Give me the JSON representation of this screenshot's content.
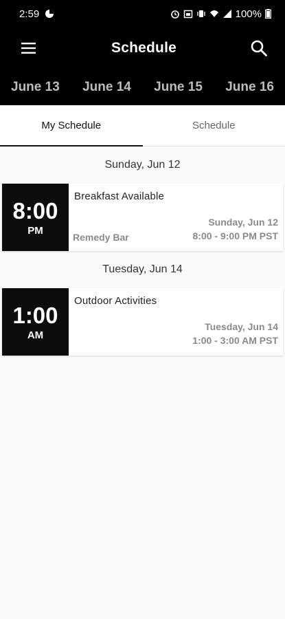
{
  "status_bar": {
    "time": "2:59",
    "battery": "100%",
    "icons": [
      "data-saver-icon",
      "alarm-icon",
      "calendar-icon",
      "vibrate-icon",
      "wifi-icon",
      "signal-icon",
      "battery-icon"
    ]
  },
  "app_bar": {
    "title": "Schedule",
    "menu_icon": "menu-icon",
    "search_icon": "search-icon"
  },
  "date_tabs": [
    {
      "label": "June 13"
    },
    {
      "label": "June 14"
    },
    {
      "label": "June 15"
    },
    {
      "label": "June 16"
    }
  ],
  "view_tabs": {
    "my_schedule": "My Schedule",
    "schedule": "Schedule",
    "active": "my_schedule"
  },
  "days": [
    {
      "header": "Sunday, Jun 12",
      "events": [
        {
          "time": "8:00",
          "ampm": "PM",
          "title": "Breakfast Available",
          "location": "Remedy Bar",
          "date": "Sunday, Jun 12",
          "range": "8:00 - 9:00 PM PST"
        }
      ]
    },
    {
      "header": "Tuesday, Jun 14",
      "events": [
        {
          "time": "1:00",
          "ampm": "AM",
          "title": "Outdoor Activities",
          "location": "",
          "date": "Tuesday, Jun 14",
          "range": "1:00 - 3:00 AM PST"
        }
      ]
    }
  ],
  "colors": {
    "header_bg": "#000000",
    "date_tab_text": "#bdbdbd",
    "time_box_bg": "#0d0d0d",
    "page_bg": "#fafafa",
    "muted_text": "#8a8a8a"
  }
}
